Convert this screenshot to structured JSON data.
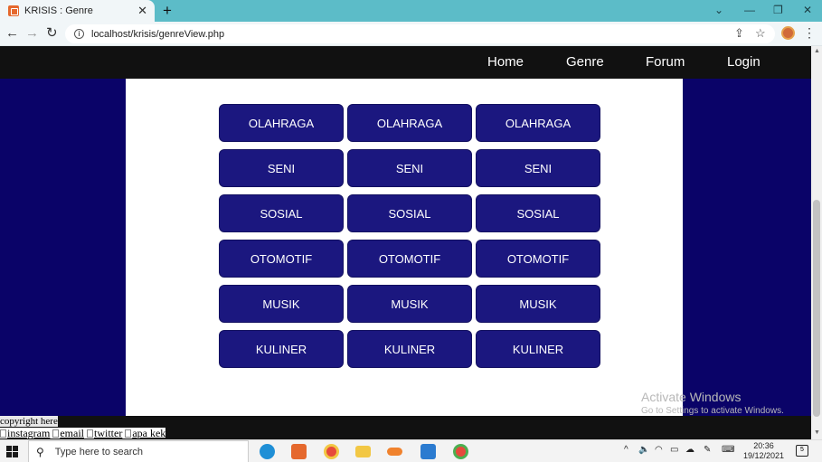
{
  "browser": {
    "tab_title": "KRISIS : Genre",
    "tab_close": "✕",
    "new_tab": "+",
    "minimize": "⌄",
    "minimize_win": "—",
    "restore": "❐",
    "close": "✕",
    "back": "←",
    "forward": "→",
    "reload": "↻",
    "url": "localhost/krisis/genreView.php",
    "share": "⇪",
    "bookmark": "☆",
    "menu": "⋮"
  },
  "nav": {
    "items": [
      "Home",
      "Genre",
      "Forum",
      "Login"
    ]
  },
  "genres": {
    "rows": [
      [
        "OLAHRAGA",
        "OLAHRAGA",
        "OLAHRAGA"
      ],
      [
        "SENI",
        "SENI",
        "SENI"
      ],
      [
        "SOSIAL",
        "SOSIAL",
        "SOSIAL"
      ],
      [
        "OTOMOTIF",
        "OTOMOTIF",
        "OTOMOTIF"
      ],
      [
        "MUSIK",
        "MUSIK",
        "MUSIK"
      ],
      [
        "KULINER",
        "KULINER",
        "KULINER"
      ]
    ]
  },
  "footer": {
    "copyright": "copyright here",
    "links": [
      "instagram",
      "email",
      "twitter",
      "apa kek"
    ]
  },
  "watermark": {
    "title": "Activate Windows",
    "subtitle": "Go to Settings to activate Windows."
  },
  "taskbar": {
    "search_placeholder": "Type here to search",
    "time": "20:36",
    "date": "19/12/2021",
    "notifications": "5",
    "colors": {
      "edge": "#1f8fd6",
      "xampp": "#e5682d",
      "chrome1": "#e64a3c",
      "files": "#f2c744",
      "cloud": "#f0822d",
      "vscode": "#2b7bd0",
      "chrome2": "#e64a3c"
    }
  },
  "colors": {
    "page_bg": "#0a0368",
    "button_bg": "#1b177f",
    "navbar_bg": "#111111",
    "tab_strip": "#5cbcc8"
  }
}
